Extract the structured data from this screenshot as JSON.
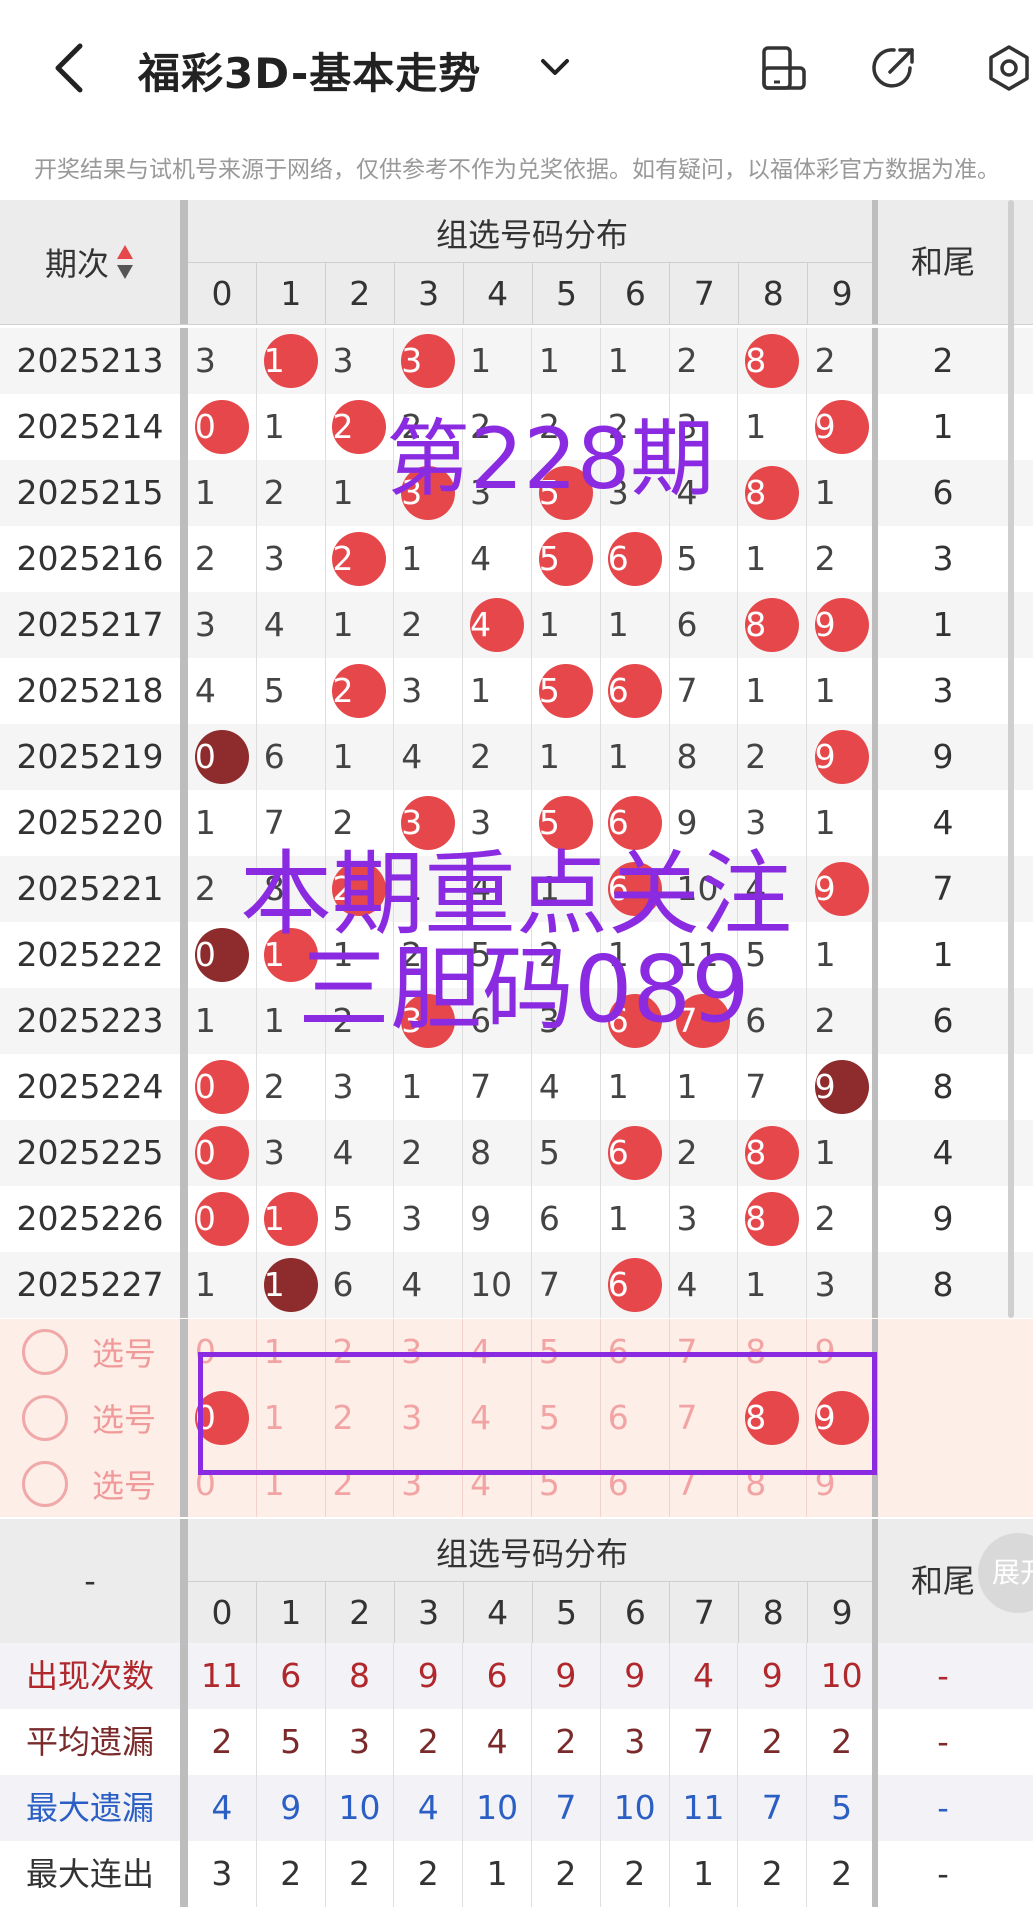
{
  "header": {
    "title": "福彩3D-基本走势",
    "notice": "开奖结果与试机号来源于网络，仅供参考不作为兑奖依据。如有疑问，以福体彩官方数据为准。"
  },
  "table_head": {
    "period_label": "期次",
    "group_label": "组选号码分布",
    "tail_label": "和尾",
    "digits": [
      "0",
      "1",
      "2",
      "3",
      "4",
      "5",
      "6",
      "7",
      "8",
      "9"
    ]
  },
  "rows": [
    {
      "period": "2025213",
      "cells": [
        "3",
        "1",
        "3",
        "3",
        "1",
        "1",
        "1",
        "2",
        "8",
        "2"
      ],
      "ball": [
        0,
        1,
        0,
        1,
        0,
        0,
        0,
        0,
        1,
        0
      ],
      "tail": "2"
    },
    {
      "period": "2025214",
      "cells": [
        "0",
        "1",
        "2",
        "2",
        "2",
        "2",
        "2",
        "3",
        "1",
        "9"
      ],
      "ball": [
        1,
        0,
        1,
        0,
        0,
        0,
        0,
        0,
        0,
        1
      ],
      "tail": "1"
    },
    {
      "period": "2025215",
      "cells": [
        "1",
        "2",
        "1",
        "3",
        "3",
        "5",
        "3",
        "4",
        "8",
        "1"
      ],
      "ball": [
        0,
        0,
        0,
        1,
        0,
        1,
        0,
        0,
        1,
        0
      ],
      "tail": "6"
    },
    {
      "period": "2025216",
      "cells": [
        "2",
        "3",
        "2",
        "1",
        "4",
        "5",
        "6",
        "5",
        "1",
        "2"
      ],
      "ball": [
        0,
        0,
        1,
        0,
        0,
        1,
        1,
        0,
        0,
        0
      ],
      "tail": "3"
    },
    {
      "period": "2025217",
      "cells": [
        "3",
        "4",
        "1",
        "2",
        "4",
        "1",
        "1",
        "6",
        "8",
        "9"
      ],
      "ball": [
        0,
        0,
        0,
        0,
        1,
        0,
        0,
        0,
        1,
        1
      ],
      "tail": "1"
    },
    {
      "period": "2025218",
      "cells": [
        "4",
        "5",
        "2",
        "3",
        "1",
        "5",
        "6",
        "7",
        "1",
        "1"
      ],
      "ball": [
        0,
        0,
        1,
        0,
        0,
        1,
        1,
        0,
        0,
        0
      ],
      "tail": "3"
    },
    {
      "period": "2025219",
      "cells": [
        "0",
        "6",
        "1",
        "4",
        "2",
        "1",
        "1",
        "8",
        "2",
        "9"
      ],
      "ball": [
        2,
        0,
        0,
        0,
        0,
        0,
        0,
        0,
        0,
        1
      ],
      "tail": "9"
    },
    {
      "period": "2025220",
      "cells": [
        "1",
        "7",
        "2",
        "3",
        "3",
        "5",
        "6",
        "9",
        "3",
        "1"
      ],
      "ball": [
        0,
        0,
        0,
        1,
        0,
        1,
        1,
        0,
        0,
        0
      ],
      "tail": "4"
    },
    {
      "period": "2025221",
      "cells": [
        "2",
        "8",
        "2",
        "1",
        "4",
        "1",
        "6",
        "10",
        "4",
        "9"
      ],
      "ball": [
        0,
        0,
        1,
        0,
        0,
        0,
        1,
        0,
        0,
        1
      ],
      "tail": "7"
    },
    {
      "period": "2025222",
      "cells": [
        "0",
        "1",
        "1",
        "2",
        "5",
        "2",
        "1",
        "11",
        "5",
        "1"
      ],
      "ball": [
        2,
        1,
        0,
        0,
        0,
        0,
        0,
        0,
        0,
        0
      ],
      "tail": "1"
    },
    {
      "period": "2025223",
      "cells": [
        "1",
        "1",
        "2",
        "3",
        "6",
        "3",
        "6",
        "7",
        "6",
        "2"
      ],
      "ball": [
        0,
        0,
        0,
        1,
        0,
        0,
        1,
        1,
        0,
        0
      ],
      "tail": "6"
    },
    {
      "period": "2025224",
      "cells": [
        "0",
        "2",
        "3",
        "1",
        "7",
        "4",
        "1",
        "1",
        "7",
        "9"
      ],
      "ball": [
        1,
        0,
        0,
        0,
        0,
        0,
        0,
        0,
        0,
        2
      ],
      "tail": "8"
    },
    {
      "period": "2025225",
      "cells": [
        "0",
        "3",
        "4",
        "2",
        "8",
        "5",
        "6",
        "2",
        "8",
        "1"
      ],
      "ball": [
        1,
        0,
        0,
        0,
        0,
        0,
        1,
        0,
        1,
        0
      ],
      "tail": "4"
    },
    {
      "period": "2025226",
      "cells": [
        "0",
        "1",
        "5",
        "3",
        "9",
        "6",
        "1",
        "3",
        "8",
        "2"
      ],
      "ball": [
        1,
        1,
        0,
        0,
        0,
        0,
        0,
        0,
        1,
        0
      ],
      "tail": "9"
    },
    {
      "period": "2025227",
      "cells": [
        "1",
        "1",
        "6",
        "4",
        "10",
        "7",
        "6",
        "4",
        "1",
        "3"
      ],
      "ball": [
        0,
        2,
        0,
        0,
        0,
        0,
        1,
        0,
        0,
        0
      ],
      "tail": "8"
    }
  ],
  "select_rows": [
    {
      "label": "选号",
      "picked": []
    },
    {
      "label": "选号",
      "picked": [
        0,
        8,
        9
      ]
    },
    {
      "label": "选号",
      "picked": []
    }
  ],
  "stats_head": {
    "dash": "-",
    "group_label": "组选号码分布",
    "tail_label": "和尾",
    "expand_label": "展开"
  },
  "stats": [
    {
      "label": "出现次数",
      "values": [
        "11",
        "6",
        "8",
        "9",
        "6",
        "9",
        "9",
        "4",
        "9",
        "10"
      ],
      "tail": "-",
      "color": "#b0282c"
    },
    {
      "label": "平均遗漏",
      "values": [
        "2",
        "5",
        "3",
        "2",
        "4",
        "2",
        "3",
        "7",
        "2",
        "2"
      ],
      "tail": "-",
      "color": "#7a2a2a"
    },
    {
      "label": "最大遗漏",
      "values": [
        "4",
        "9",
        "10",
        "4",
        "10",
        "7",
        "10",
        "11",
        "7",
        "5"
      ],
      "tail": "-",
      "color": "#2c5fc4"
    },
    {
      "label": "最大连出",
      "values": [
        "3",
        "2",
        "2",
        "2",
        "1",
        "2",
        "2",
        "1",
        "2",
        "2"
      ],
      "tail": "-",
      "color": "#333333"
    }
  ],
  "overlay": {
    "issue": "第228期",
    "line1": "本期重点关注",
    "line2": "三胆码089",
    "color": "#8a2be2"
  },
  "colors": {
    "ball_red": "#e5474b",
    "ball_dark": "#8e2b2c",
    "select_bg": "#fdeee8",
    "header_gray": "#ececec"
  }
}
